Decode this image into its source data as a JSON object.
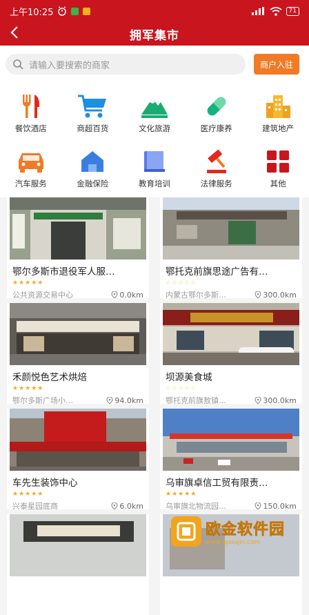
{
  "status_bar": {
    "time": "上午10:25",
    "battery": "71"
  },
  "header": {
    "back_icon": "chevron-left-icon",
    "title": "拥军集市"
  },
  "search": {
    "placeholder": "请输入要搜索的商家",
    "merchant_button": "商户入驻"
  },
  "categories": [
    {
      "label": "餐饮酒店",
      "icon": "fork-knife-icon"
    },
    {
      "label": "商超百货",
      "icon": "shopping-cart-icon"
    },
    {
      "label": "文化旅游",
      "icon": "mountain-icon"
    },
    {
      "label": "医疗康养",
      "icon": "pill-icon"
    },
    {
      "label": "建筑地产",
      "icon": "building-icon"
    },
    {
      "label": "汽车服务",
      "icon": "car-icon"
    },
    {
      "label": "金融保险",
      "icon": "house-shield-icon"
    },
    {
      "label": "教育培训",
      "icon": "book-icon"
    },
    {
      "label": "法律服务",
      "icon": "gavel-icon"
    },
    {
      "label": "其他",
      "icon": "grid-icon"
    }
  ],
  "shops": [
    {
      "name": "鄂尔多斯市退役军人服…",
      "rating": 5,
      "address": "公共资源交易中心",
      "distance": "0.0km"
    },
    {
      "name": "鄂托克前旗思途广告有…",
      "rating": 0,
      "address": "内蒙古鄂尔多斯…",
      "distance": "300.0km"
    },
    {
      "name": "禾颜悦色艺术烘焙",
      "rating": 5,
      "address": "鄂尔多斯广场小…",
      "distance": "94.0km"
    },
    {
      "name": "坝源美食城",
      "rating": 0,
      "address": "鄂托克前旗敖镇…",
      "distance": "300.0km"
    },
    {
      "name": "车先生装饰中心",
      "rating": 5,
      "address": "兴泰星园底商",
      "distance": "6.0km"
    },
    {
      "name": "乌审旗卓信工贸有限责…",
      "rating": 5,
      "address": "乌审旗北物流园…",
      "distance": "150.0km"
    }
  ],
  "watermark": {
    "logo_text": "欧金软件园",
    "url_text": "www.apoujin.com"
  },
  "colors": {
    "brand_red": "#c9151e",
    "accent_orange": "#f07a25",
    "star": "#f5a623"
  }
}
